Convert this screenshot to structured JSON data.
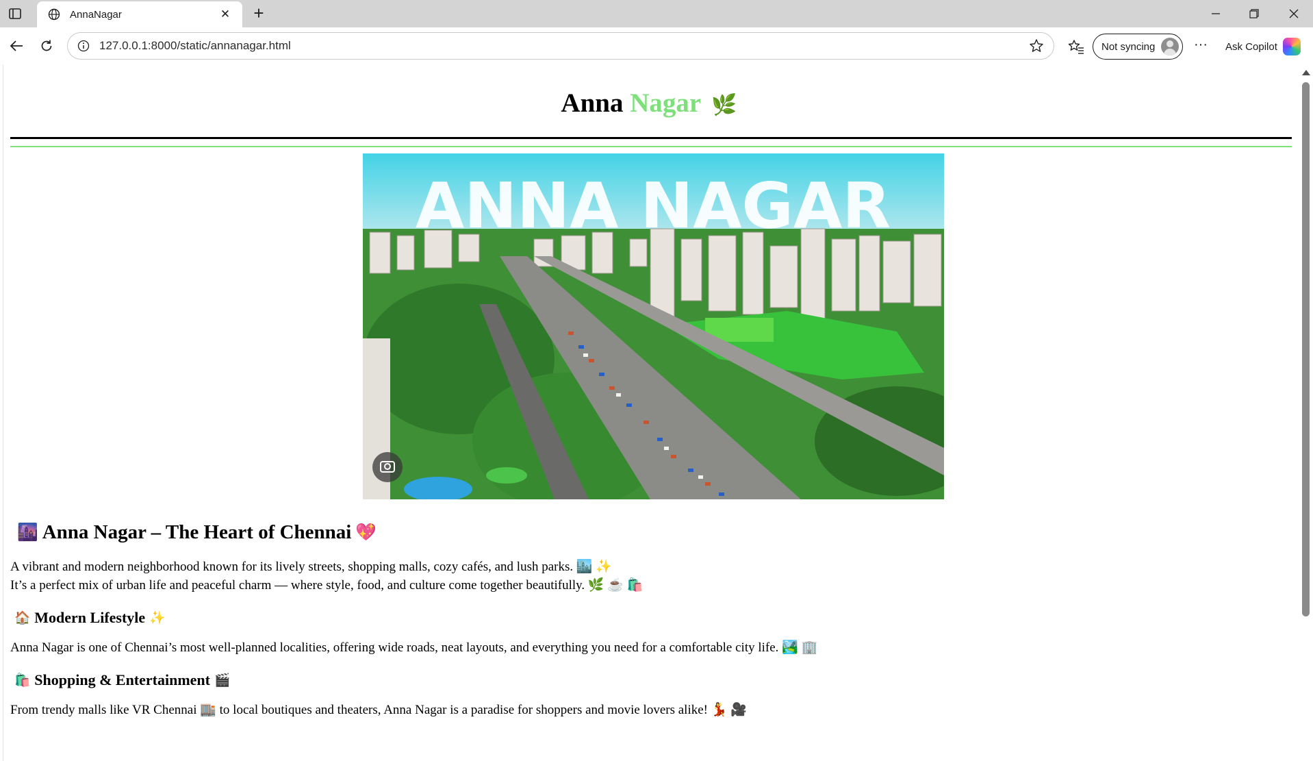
{
  "browser": {
    "tab_title": "AnnaNagar",
    "url": "127.0.0.1:8000/static/annanagar.html",
    "sync_label": "Not syncing",
    "copilot_label": "Ask Copilot",
    "icons": [
      "sidebar-icon",
      "globe-icon",
      "close-icon",
      "new-tab-icon",
      "minimize-icon",
      "restore-icon",
      "window-close-icon",
      "back-icon",
      "refresh-icon",
      "info-icon",
      "favorite-star-icon",
      "favorites-icon",
      "profile-avatar-icon",
      "more-icon",
      "copilot-icon"
    ]
  },
  "page": {
    "title_part1": "Anna",
    "title_part2": "Nagar",
    "title_emoji": "🌿",
    "accent_color": "#7ee07a",
    "hero_caption": "ANNA NAGAR",
    "intro": {
      "emoji_left": "🌆",
      "heading": "Anna Nagar – The Heart of Chennai",
      "emoji_right": "💖",
      "line1": "A vibrant and modern neighborhood known for its lively streets, shopping malls, cozy cafés, and lush parks. 🏙️ ✨",
      "line2": "It’s a perfect mix of urban life and peaceful charm — where style, food, and culture come together beautifully. 🌿 ☕ 🛍️"
    },
    "sections": [
      {
        "emoji_left": "🏠",
        "heading": "Modern Lifestyle",
        "emoji_right": "✨",
        "text": "Anna Nagar is one of Chennai’s most well-planned localities, offering wide roads, neat layouts, and everything you need for a comfortable city life. 🏞️ 🏢"
      },
      {
        "emoji_left": "🛍️",
        "heading": "Shopping & Entertainment",
        "emoji_right": "🎬",
        "text": "From trendy malls like VR Chennai 🏬 to local boutiques and theaters, Anna Nagar is a paradise for shoppers and movie lovers alike! 💃 🎥"
      }
    ]
  }
}
